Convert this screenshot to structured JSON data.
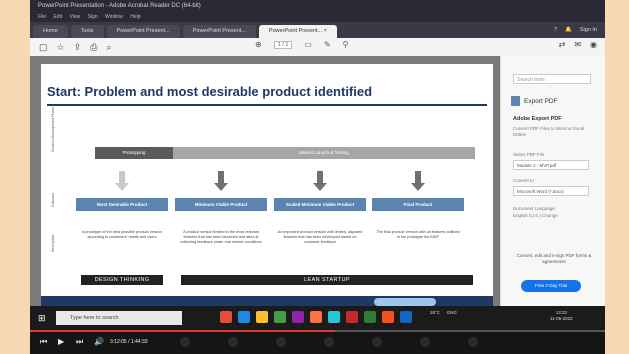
{
  "window": {
    "title": "PowerPoint Presentation - Adobe Acrobat Reader DC (64-bit)",
    "menu": [
      "File",
      "Edit",
      "View",
      "Sign",
      "Window",
      "Help"
    ]
  },
  "tabs": [
    {
      "label": "Home"
    },
    {
      "label": "Tools"
    },
    {
      "label": "PowerPoint Present..."
    },
    {
      "label": "PowerPoint Present..."
    },
    {
      "label": "PowerPoint Present... ×"
    }
  ],
  "tab_right": {
    "help": "?",
    "bell": "🔔",
    "signin": "Sign In"
  },
  "toolbar": {
    "page_indicator": "1 / 1",
    "icons": [
      "star-icon",
      "upload-icon",
      "print-icon",
      "search-icon"
    ],
    "right_icons": [
      "share-icon",
      "mail-icon",
      "account-icon"
    ]
  },
  "slide": {
    "title": "Start: Problem and most desirable product identified",
    "row_labels": [
      "Solution Development Phase",
      "Outcome",
      "Description"
    ],
    "phases": [
      {
        "label": "Prototyping"
      },
      {
        "label": "Market Launch & Testing"
      }
    ],
    "products": [
      {
        "label": "Most Desirable Product",
        "desc": "A prototype of the best possible product version according to customers' needs and users"
      },
      {
        "label": "Minimum Viable Product",
        "desc": "A product version limited to the most relevant features that has been launched and aims at collecting feedback under real market conditions"
      },
      {
        "label": "Scaled Minimum Viable Product",
        "desc": "An improved product version with limited, adjusted features that has been developed based on customer feedback"
      },
      {
        "label": "Final Product",
        "desc": "The final product version with all features outlined in the prototype the MDP"
      }
    ],
    "bottom_bars": [
      {
        "label": "DESIGN THINKING"
      },
      {
        "label": "LEAN STARTUP"
      }
    ]
  },
  "side_panel": {
    "search_placeholder": "Search tools",
    "export_title": "Export PDF",
    "heading": "Adobe Export PDF",
    "subtitle": "Convert PDF Files to Word or Excel Online",
    "select_label": "Select PDF File",
    "selected_file": "Module 2 - MVP.pdf",
    "convert_to_label": "Convert to",
    "convert_to_value": "Microsoft Word (*.docx)",
    "doc_lang_label": "Document Language:",
    "doc_lang_value": "English (U.S.) Change",
    "convert_text": "Convert, edit and e-sign PDF forms & agreements",
    "trial_button": "Free 7-Day Trial"
  },
  "taskbar": {
    "search_placeholder": "Type here to search",
    "weather": "26°C",
    "lang": "ENG",
    "time": "13:22",
    "date": "11-05-2022",
    "app_colors": [
      "#e74c3c",
      "#1e88e5",
      "#fbc02d",
      "#43a047",
      "#8e24aa",
      "#ff7043",
      "#26c6da",
      "#c62828",
      "#2e7d32",
      "#f4511e",
      "#1565c0"
    ]
  },
  "video": {
    "time": "3:12:05 / 1:44:33",
    "progress": 0.53
  },
  "colors": {
    "accent": "#1f3864",
    "product_box": "#5b84b1",
    "trial_button": "#1473e6"
  }
}
